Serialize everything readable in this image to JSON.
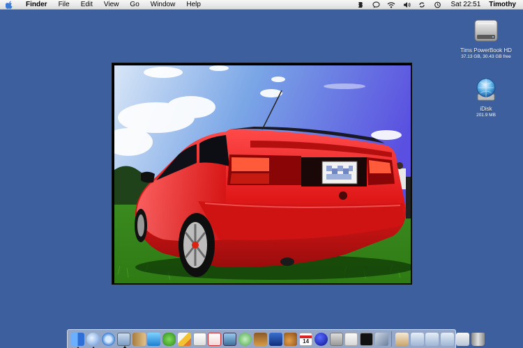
{
  "menubar": {
    "apple_icon": "apple-icon",
    "app_name": "Finder",
    "menus": [
      "File",
      "Edit",
      "View",
      "Go",
      "Window",
      "Help"
    ],
    "status_icons": [
      "script-icon",
      "ichat-icon",
      "airport-icon",
      "volume-icon",
      "sync-icon",
      "time-machine-icon"
    ],
    "clock": "Sat 22:51",
    "user": "Timothy"
  },
  "desktop": {
    "background_color": "#3d5f9e",
    "icons": [
      {
        "icon": "hard-drive-icon",
        "label": "Tims PowerBook HD",
        "sub": "37.13 GB, 30.43 GB free"
      },
      {
        "icon": "idisk-icon",
        "label": "iDisk",
        "sub": "201.9 MB"
      }
    ]
  },
  "photo": {
    "subject": "red-car-photo",
    "frame_color": "#000000"
  },
  "dock": {
    "apps": [
      "finder-icon",
      "ichat-icon",
      "safari-icon",
      "preview-icon",
      "address-book-icon",
      "itunes-wave-icon",
      "frog-icon",
      "pencil-icon",
      "textedit-icon",
      "acrobat-icon",
      "iphoto-icon",
      "itunes-icon",
      "garageband-photo-icon",
      "imovie-icon",
      "guitar-icon",
      "ical-icon",
      "smiley-icon",
      "calculator-icon",
      "notes-icon",
      "terminal-icon",
      "tool-icon"
    ],
    "ical_date": "14",
    "places": [
      "home-icon",
      "documents-folder-icon",
      "applications-folder-icon",
      "downloads-folder-icon",
      "pictures-folder-icon",
      "trash-icon"
    ]
  }
}
